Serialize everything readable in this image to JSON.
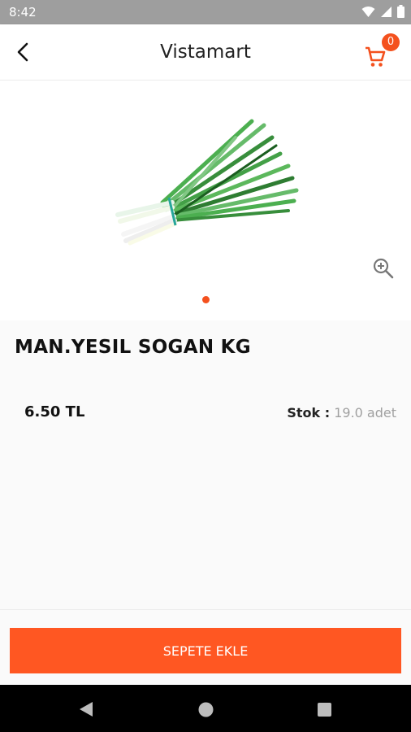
{
  "status_bar": {
    "time": "8:42"
  },
  "app_bar": {
    "title": "Vistamart",
    "cart_count": "0"
  },
  "product": {
    "name": "MAN.YESIL SOGAN KG",
    "price": "6.50 TL",
    "stock_label": "Stok :",
    "stock_value": "19.0 adet"
  },
  "actions": {
    "add_to_cart": "SEPETE EKLE"
  },
  "colors": {
    "accent": "#ff5722",
    "badge": "#f4511e",
    "status_bar": "#9e9e9e"
  }
}
